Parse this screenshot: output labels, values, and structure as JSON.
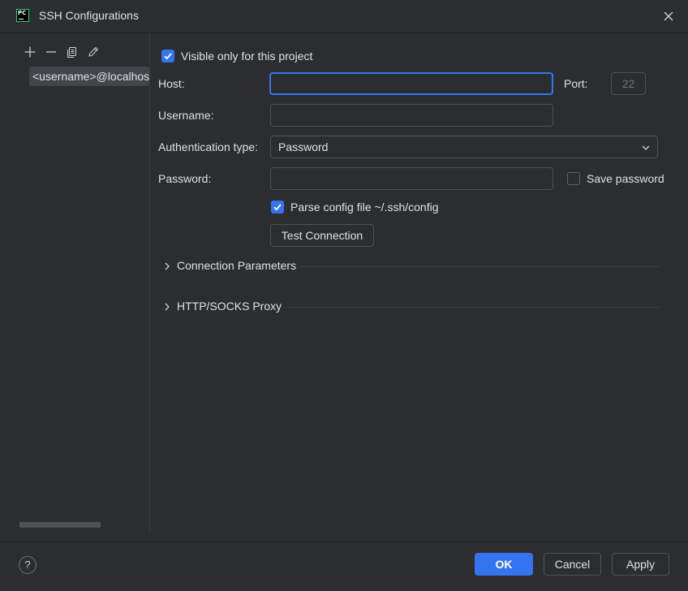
{
  "window": {
    "title": "SSH Configurations"
  },
  "icons": {
    "app": "pycharm-logo",
    "app_text": "PC",
    "close": "close-icon",
    "add": "plus-icon",
    "remove": "minus-icon",
    "copy": "copy-icon",
    "edit": "pencil-icon",
    "dropdown": "chevron-down-icon",
    "expand": "chevron-right-icon",
    "help": "question-icon"
  },
  "sidebar": {
    "items": [
      {
        "label": "<username>@localhost"
      }
    ]
  },
  "form": {
    "visible_only": {
      "label": "Visible only for this project",
      "checked": true
    },
    "host": {
      "label": "Host:",
      "value": "",
      "placeholder": ""
    },
    "port": {
      "label": "Port:",
      "value": "22"
    },
    "username": {
      "label": "Username:",
      "value": ""
    },
    "auth_type": {
      "label": "Authentication type:",
      "value": "Password"
    },
    "password": {
      "label": "Password:",
      "value": ""
    },
    "save_password": {
      "label": "Save password",
      "checked": false
    },
    "parse_config": {
      "label": "Parse config file ~/.ssh/config",
      "checked": true
    },
    "test_connection": {
      "label": "Test Connection"
    }
  },
  "sections": [
    {
      "title": "Connection Parameters",
      "expanded": false
    },
    {
      "title": "HTTP/SOCKS Proxy",
      "expanded": false
    }
  ],
  "footer": {
    "help": "?",
    "ok": "OK",
    "cancel": "Cancel",
    "apply": "Apply"
  },
  "colors": {
    "background": "#2b2d30",
    "accent": "#3574f0",
    "border": "#4e5157",
    "text": "#dfe1e5",
    "selection": "#43454a"
  }
}
